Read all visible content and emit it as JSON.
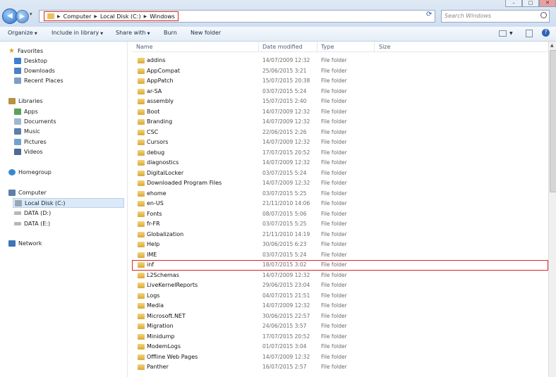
{
  "window": {
    "min": "–",
    "max": "□",
    "close": "✕"
  },
  "nav": {
    "back": "◀",
    "forward": "▶",
    "drop": "▾"
  },
  "address": {
    "crumbs": [
      "Computer",
      "Local Disk (C:)",
      "Windows"
    ]
  },
  "search": {
    "placeholder": "Search Windows"
  },
  "toolbar": {
    "organize": "Organize",
    "include": "Include in library",
    "share": "Share with",
    "burn": "Burn",
    "new_folder": "New folder"
  },
  "sidebar": {
    "favorites": "Favorites",
    "desktop": "Desktop",
    "downloads": "Downloads",
    "recent": "Recent Places",
    "libraries": "Libraries",
    "apps": "Apps",
    "documents": "Documents",
    "music": "Music",
    "pictures": "Pictures",
    "videos": "Videos",
    "homegroup": "Homegroup",
    "computer": "Computer",
    "local_disk": "Local Disk (C:)",
    "data_d": "DATA (D:)",
    "data_e": "DATA (E:)",
    "network": "Network"
  },
  "columns": {
    "name": "Name",
    "date": "Date modified",
    "type": "Type",
    "size": "Size"
  },
  "files": [
    {
      "name": "addins",
      "date": "14/07/2009 12:32",
      "type": "File folder"
    },
    {
      "name": "AppCompat",
      "date": "25/06/2015 3:21",
      "type": "File folder"
    },
    {
      "name": "AppPatch",
      "date": "15/07/2015 20:38",
      "type": "File folder"
    },
    {
      "name": "ar-SA",
      "date": "03/07/2015 5:24",
      "type": "File folder"
    },
    {
      "name": "assembly",
      "date": "15/07/2015 2:40",
      "type": "File folder"
    },
    {
      "name": "Boot",
      "date": "14/07/2009 12:32",
      "type": "File folder"
    },
    {
      "name": "Branding",
      "date": "14/07/2009 12:32",
      "type": "File folder"
    },
    {
      "name": "CSC",
      "date": "22/06/2015 2:26",
      "type": "File folder"
    },
    {
      "name": "Cursors",
      "date": "14/07/2009 12:32",
      "type": "File folder"
    },
    {
      "name": "debug",
      "date": "17/07/2015 20:52",
      "type": "File folder"
    },
    {
      "name": "diagnostics",
      "date": "14/07/2009 12:32",
      "type": "File folder"
    },
    {
      "name": "DigitalLocker",
      "date": "03/07/2015 5:24",
      "type": "File folder"
    },
    {
      "name": "Downloaded Program Files",
      "date": "14/07/2009 12:32",
      "type": "File folder"
    },
    {
      "name": "ehome",
      "date": "03/07/2015 5:25",
      "type": "File folder"
    },
    {
      "name": "en-US",
      "date": "21/11/2010 14:06",
      "type": "File folder"
    },
    {
      "name": "Fonts",
      "date": "08/07/2015 5:06",
      "type": "File folder"
    },
    {
      "name": "fr-FR",
      "date": "03/07/2015 5:25",
      "type": "File folder"
    },
    {
      "name": "Globalization",
      "date": "21/11/2010 14:19",
      "type": "File folder"
    },
    {
      "name": "Help",
      "date": "30/06/2015 6:23",
      "type": "File folder"
    },
    {
      "name": "IME",
      "date": "03/07/2015 5:24",
      "type": "File folder"
    },
    {
      "name": "inf",
      "date": "18/07/2015 3:02",
      "type": "File folder"
    },
    {
      "name": "L2Schemas",
      "date": "14/07/2009 12:32",
      "type": "File folder"
    },
    {
      "name": "LiveKernelReports",
      "date": "29/06/2015 23:04",
      "type": "File folder"
    },
    {
      "name": "Logs",
      "date": "04/07/2015 21:51",
      "type": "File folder"
    },
    {
      "name": "Media",
      "date": "14/07/2009 12:32",
      "type": "File folder"
    },
    {
      "name": "Microsoft.NET",
      "date": "30/06/2015 22:57",
      "type": "File folder"
    },
    {
      "name": "Migration",
      "date": "24/06/2015 3:57",
      "type": "File folder"
    },
    {
      "name": "Minidump",
      "date": "17/07/2015 20:52",
      "type": "File folder"
    },
    {
      "name": "ModemLogs",
      "date": "01/07/2015 3:04",
      "type": "File folder"
    },
    {
      "name": "Offline Web Pages",
      "date": "14/07/2009 12:32",
      "type": "File folder"
    },
    {
      "name": "Panther",
      "date": "16/07/2015 2:57",
      "type": "File folder"
    }
  ],
  "highlight_color": "#d9262e"
}
